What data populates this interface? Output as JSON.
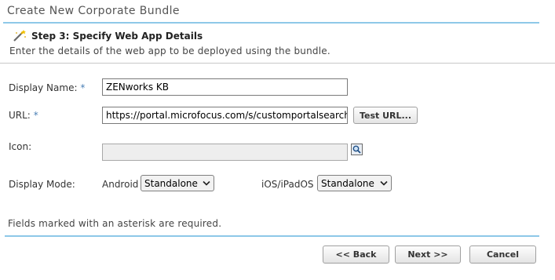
{
  "window": {
    "title": "Create New Corporate Bundle"
  },
  "step": {
    "title": "Step 3: Specify Web App Details",
    "description": "Enter the details of the web app to be deployed using the bundle."
  },
  "form": {
    "display_name": {
      "label": "Display Name:",
      "required_marker": "*",
      "value": "ZENworks KB"
    },
    "url": {
      "label": "URL:",
      "required_marker": "*",
      "value": "https://portal.microfocus.com/s/customportalsearch?",
      "test_button": "Test URL..."
    },
    "icon": {
      "label": "Icon:",
      "value": "",
      "browse_icon": "search-icon"
    },
    "display_mode": {
      "label": "Display Mode:",
      "android_label": "Android",
      "android_value": "Standalone",
      "ios_label": "iOS/iPadOS",
      "ios_value": "Standalone"
    }
  },
  "note": "Fields marked with an asterisk are required.",
  "navigation": {
    "back_label": "<< Back",
    "next_label": "Next >>",
    "cancel_label": "Cancel"
  },
  "colors": {
    "accent_rule": "#8ec8e8",
    "required": "#4a7fb5"
  }
}
